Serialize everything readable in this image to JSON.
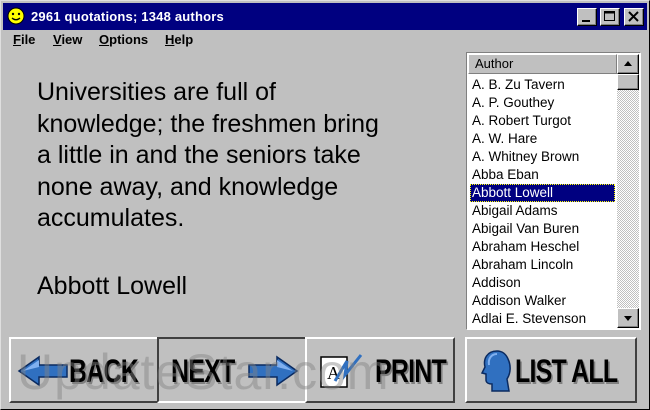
{
  "window": {
    "title": "2961 quotations; 1348 authors",
    "icon": "smiley-icon",
    "controls": [
      "minimize-icon",
      "maximize-icon",
      "close-icon"
    ]
  },
  "menu": {
    "items": [
      {
        "label_u": "F",
        "label_rest": "ile"
      },
      {
        "label_u": "V",
        "label_rest": "iew"
      },
      {
        "label_u": "O",
        "label_rest": "ptions"
      },
      {
        "label_u": "H",
        "label_rest": "elp"
      }
    ]
  },
  "quote": {
    "lines": [
      "Universities are full of",
      "knowledge; the freshmen bring",
      "a little in and the seniors take",
      "none away, and knowledge",
      "accumulates."
    ],
    "author": "Abbott Lowell"
  },
  "author_list": {
    "header": "Author",
    "selected_index": 6,
    "items": [
      "A. B. Zu Tavern",
      "A. P. Gouthey",
      "A. Robert Turgot",
      "A. W. Hare",
      "A. Whitney Brown",
      "Abba Eban",
      "Abbott Lowell",
      "Abigail Adams",
      "Abigail Van Buren",
      "Abraham Heschel",
      "Abraham Lincoln",
      "Addison",
      "Addison Walker",
      "Adlai E. Stevenson"
    ]
  },
  "buttons": {
    "back": "BACK",
    "next": "NEXT",
    "print": "PRINT",
    "list_all": "LIST ALL"
  },
  "watermark": "UpdateStar.com",
  "colors": {
    "titlebar": "#000080",
    "selection": "#000080",
    "face": "#c0c0c0",
    "arrow_blue": "#3070c0"
  }
}
